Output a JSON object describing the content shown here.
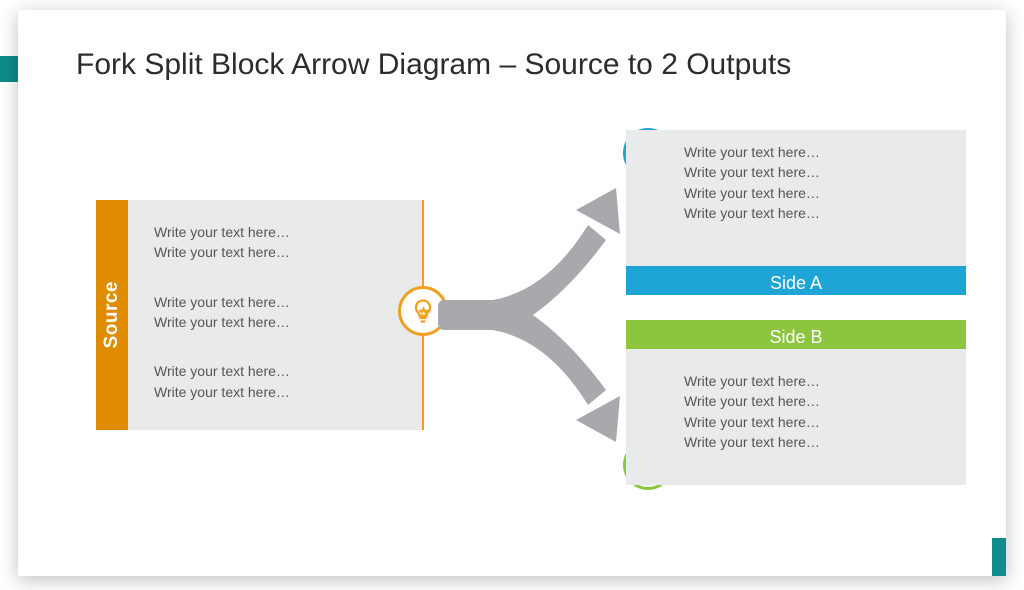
{
  "title": "Fork Split Block Arrow Diagram – Source to 2 Outputs",
  "placeholder": "Write your text here…",
  "source": {
    "label": "Source",
    "lines": [
      "Write your text here…",
      "Write your text here…",
      "Write your text here…",
      "Write your text here…",
      "Write your text here…",
      "Write your text here…"
    ]
  },
  "outputA": {
    "label": "Side A",
    "lines": [
      "Write your text here…",
      "Write your text here…",
      "Write your text here…",
      "Write your text here…"
    ]
  },
  "outputB": {
    "label": "Side B",
    "lines": [
      "Write your text here…",
      "Write your text here…",
      "Write your text here…",
      "Write your text here…"
    ]
  },
  "colors": {
    "source": "#e08c00",
    "sourceAccent": "#f0a020",
    "sideA": "#1fa4d6",
    "sideB": "#8cc63f",
    "arrow": "#a7a9ac",
    "panel": "#e9eaeb"
  },
  "icons": {
    "source": "lightbulb-icon",
    "sideA": "pie-chart-icon",
    "sideB": "sliders-icon"
  }
}
